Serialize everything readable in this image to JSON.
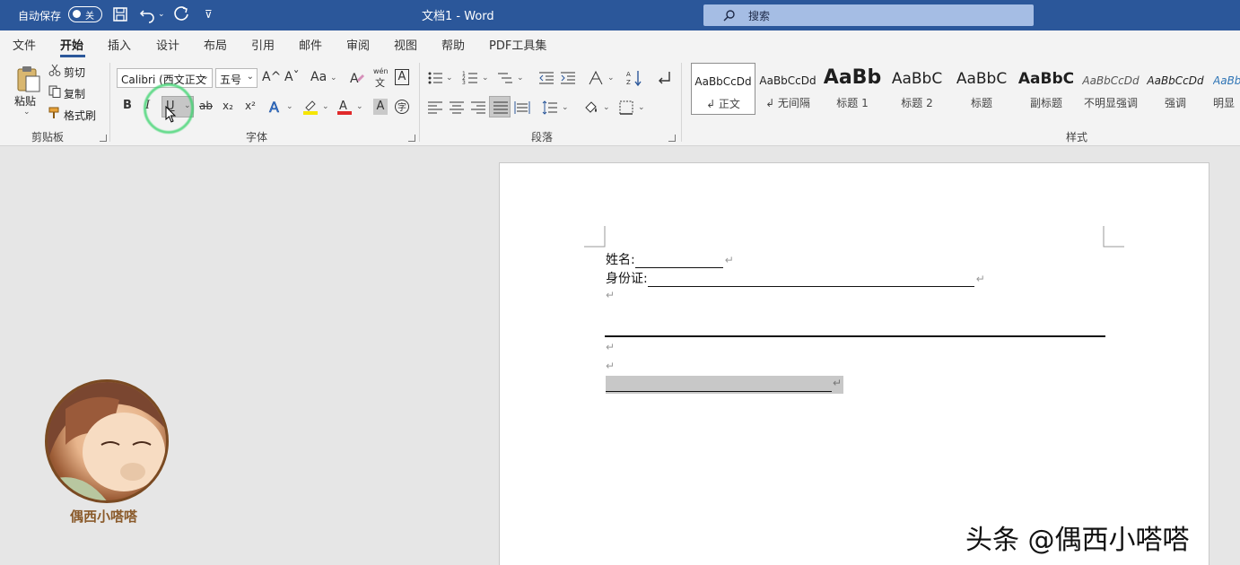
{
  "titlebar": {
    "autosave_label": "自动保存",
    "autosave_state": "关",
    "doc_title": "文档1  -  Word",
    "search_placeholder": "搜索"
  },
  "menu": {
    "tabs": [
      "文件",
      "开始",
      "插入",
      "设计",
      "布局",
      "引用",
      "邮件",
      "审阅",
      "视图",
      "帮助",
      "PDF工具集"
    ],
    "active_tab": "开始"
  },
  "ribbon": {
    "clipboard": {
      "paste": "粘贴",
      "cut": "剪切",
      "copy": "复制",
      "format_painter": "格式刷",
      "group_label": "剪贴板"
    },
    "font": {
      "font_name": "Calibri (西文正文",
      "font_size": "五号",
      "bold": "B",
      "italic": "I",
      "underline": "U",
      "strike": "ab",
      "subscript": "x₂",
      "superscript": "x²",
      "grow": "A^",
      "shrink": "Aˇ",
      "change_case": "Aa",
      "phonetic_top": "wén",
      "phonetic_bottom": "文",
      "border_char": "A",
      "group_label": "字体"
    },
    "paragraph": {
      "group_label": "段落"
    },
    "styles": {
      "group_label": "样式",
      "items": [
        {
          "sample": "AaBbCcDd",
          "name": "↲ 正文"
        },
        {
          "sample": "AaBbCcDd",
          "name": "↲ 无间隔"
        },
        {
          "sample": "AaBb",
          "name": "标题 1"
        },
        {
          "sample": "AaBbC",
          "name": "标题 2"
        },
        {
          "sample": "AaBbC",
          "name": "标题"
        },
        {
          "sample": "AaBbC",
          "name": "副标题"
        },
        {
          "sample": "AaBbCcDd",
          "name": "不明显强调"
        },
        {
          "sample": "AaBbCcDd",
          "name": "强调"
        },
        {
          "sample": "AaBb",
          "name": "明显"
        }
      ]
    }
  },
  "document": {
    "line1_label": "姓名:",
    "line2_label": "身份证:",
    "para_mark": "↵"
  },
  "overlay": {
    "avatar_label": "偶西小嗒嗒",
    "watermark": "头条 @偶西小嗒嗒"
  },
  "colors": {
    "titlebar": "#2b579a",
    "highlight_ring": "#36d36a",
    "font_color_bar": "#e0292a",
    "highlight_bar": "#f5e500"
  }
}
